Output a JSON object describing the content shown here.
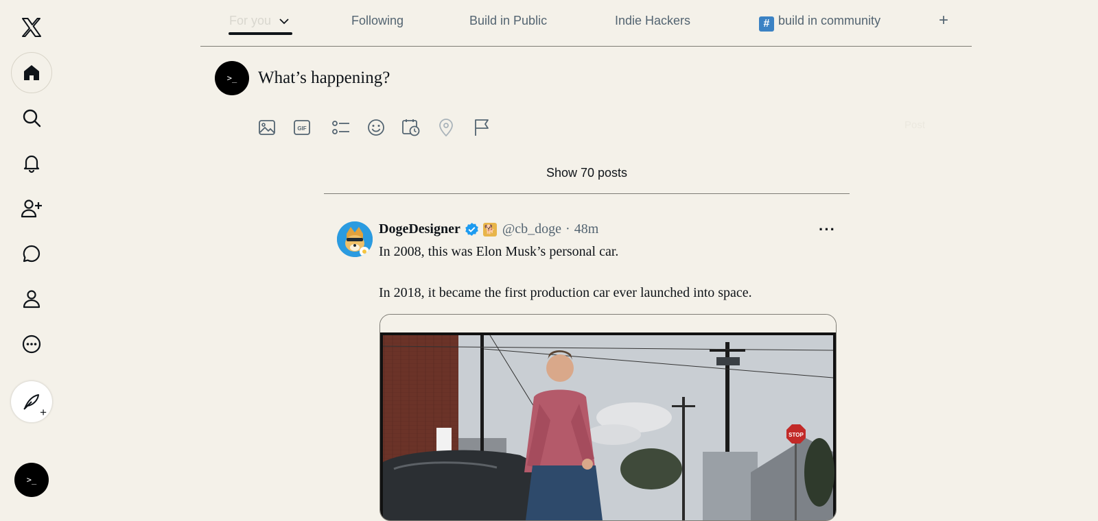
{
  "tabs": {
    "items": [
      "For you",
      "Following",
      "Build in Public",
      "Indie Hackers",
      "build in community"
    ],
    "add": "+"
  },
  "sidebar": {
    "icons": [
      "x-logo-icon",
      "home-icon",
      "search-icon",
      "notifications-icon",
      "follow-icon",
      "messages-icon",
      "profile-icon",
      "more-icon",
      "compose-icon"
    ],
    "avatar_text": ">_"
  },
  "composer": {
    "avatar_text": ">_",
    "placeholder": "What’s happening?",
    "tools": [
      "image-icon",
      "gif-icon",
      "poll-icon",
      "emoji-icon",
      "schedule-icon",
      "location-icon",
      "flag-icon"
    ],
    "post_label": "Post"
  },
  "feed": {
    "show_posts": "Show 70 posts"
  },
  "tweet": {
    "name": "DogeDesigner",
    "handle": "@cb_doge",
    "dot": "·",
    "time": "48m",
    "more": "···",
    "line1": "In 2008, this was Elon Musk’s personal car.",
    "line2": "In 2018, it became the first production car ever launched into space.",
    "media_sign": "STOP"
  },
  "colors": {
    "background": "#f4f1e9",
    "text": "#0f1419",
    "muted": "#536471",
    "verified": "#1d9bf0",
    "community": "#3b82c4"
  }
}
